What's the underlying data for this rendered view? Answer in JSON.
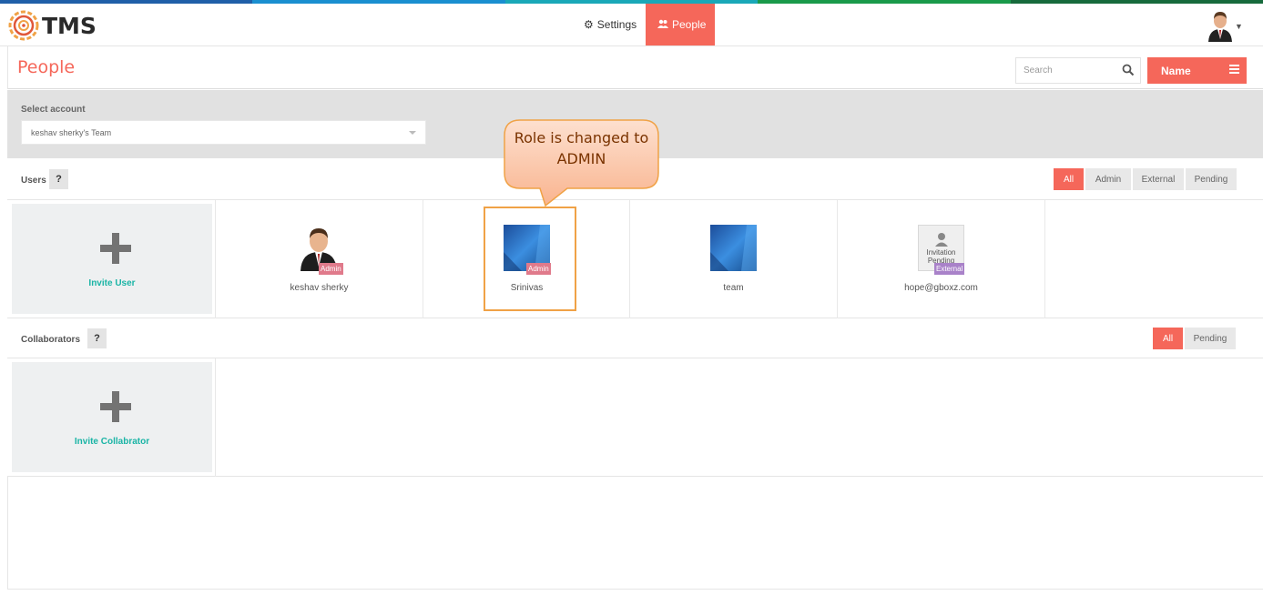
{
  "colors": {
    "accent": "#f5675a",
    "invite_text": "#19b4a5",
    "admin_badge": "#e07a8b",
    "external_badge": "#a982c9",
    "callout_border": "#f0a246"
  },
  "navbar": {
    "logo_text": "TMS",
    "settings_label": "Settings",
    "people_label": "People",
    "settings_icon": "gear-icon",
    "people_icon": "people-icon"
  },
  "header": {
    "title": "People",
    "search_placeholder": "Search",
    "sort_label": "Name"
  },
  "account": {
    "label": "Select account",
    "selected": "keshav sherky's Team"
  },
  "users": {
    "title": "Users",
    "help": "?",
    "filters": [
      "All",
      "Admin",
      "External",
      "Pending"
    ],
    "invite_label": "Invite User",
    "list": [
      {
        "name": "keshav sherky",
        "badge": "Admin",
        "avatar": "person-avatar-icon"
      },
      {
        "name": "Srinivas",
        "badge": "Admin",
        "avatar": "blue-avatar-icon"
      },
      {
        "name": "team",
        "badge": "",
        "avatar": "blue-avatar-icon"
      },
      {
        "name": "hope@gboxz.com",
        "badge": "External",
        "avatar": "pending-avatar-icon",
        "pending_text": "Invitation Pending"
      }
    ]
  },
  "collaborators": {
    "title": "Collaborators",
    "help": "?",
    "filters": [
      "All",
      "Pending"
    ],
    "invite_label": "Invite Collabrator"
  },
  "callout": {
    "line1": "Role is changed to",
    "line2": "ADMIN"
  }
}
